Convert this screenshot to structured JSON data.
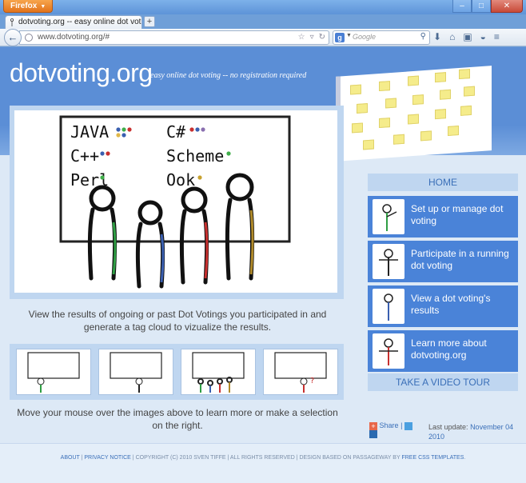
{
  "browser": {
    "app_button": "Firefox",
    "tab_title": "dotvoting.org -- easy online dot voting -...",
    "url": "www.dotvoting.org/#",
    "search_placeholder": "Google"
  },
  "header": {
    "site_title": "dotvoting.org",
    "tagline": "easy online dot voting -- no registration required"
  },
  "hero": {
    "board_lines": [
      {
        "lang": "JAVA",
        "dots": [
          "#3a5fb0",
          "#3fae4a",
          "#c8302f",
          "#e0b84a",
          "#3a5fb0"
        ]
      },
      {
        "lang": "C#",
        "dots": [
          "#c8302f",
          "#3a5fb0",
          "#8a6fb0"
        ]
      },
      {
        "lang": "C++",
        "dots": [
          "#3a5fb0",
          "#c8302f"
        ]
      },
      {
        "lang": "Scheme",
        "dots": [
          "#3fae4a"
        ]
      },
      {
        "lang": "Perl",
        "dots": [
          "#3fae4a"
        ]
      },
      {
        "lang": "Ook",
        "dots": [
          "#c8a230"
        ]
      }
    ],
    "description": "View the results of ongoing or past Dot Votings you participated in and generate a tag cloud to vizualize the results."
  },
  "thumbs_description": "Move your mouse over the images above to learn more or make a selection on the right.",
  "nav": {
    "home": "HOME",
    "items": [
      {
        "label": "Set up or manage dot voting"
      },
      {
        "label": "Participate in a running dot voting"
      },
      {
        "label": "View a dot voting's results"
      },
      {
        "label": "Learn more about dotvoting.org"
      }
    ],
    "video_tour": "TAKE A VIDEO TOUR"
  },
  "share": {
    "label": "Share",
    "sep": "|",
    "last_update_label": "Last update:",
    "last_update_date": "November 04 2010"
  },
  "footer": {
    "about": "ABOUT",
    "privacy": "PRIVACY NOTICE",
    "copyright": "COPYRIGHT (C) 2010 SVEN TIFFE | ALL RIGHTS RESERVED | DESIGN BASED ON PASSAGEWAY BY",
    "templates": "FREE CSS TEMPLATES"
  },
  "colors": {
    "header_blue": "#5b8ed6",
    "nav_blue": "#4a83d8",
    "link_blue": "#3a6fb8"
  }
}
